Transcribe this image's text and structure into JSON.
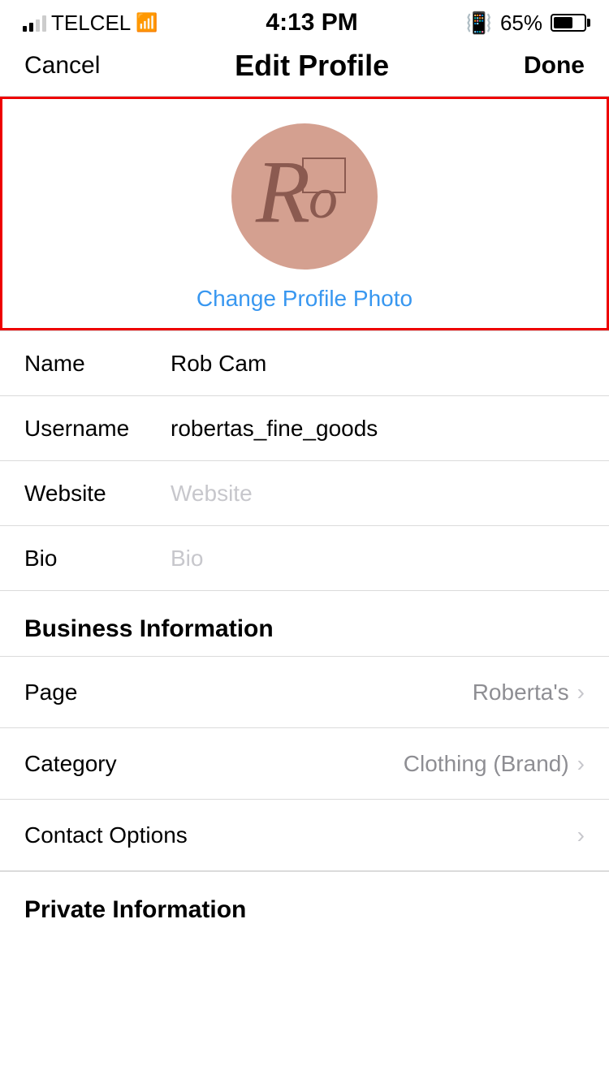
{
  "statusBar": {
    "carrier": "TELCEL",
    "time": "4:13 PM",
    "battery": "65%"
  },
  "nav": {
    "cancel": "Cancel",
    "title": "Edit Profile",
    "done": "Done"
  },
  "photo": {
    "changeText": "Change Profile Photo",
    "avatarLetter": "Ro"
  },
  "form": {
    "nameLabel": "Name",
    "nameValue": "Rob Cam",
    "usernameLabel": "Username",
    "usernameValue": "robertas_fine_goods",
    "websiteLabel": "Website",
    "websitePlaceholder": "Website",
    "bioLabel": "Bio",
    "bioPlaceholder": "Bio"
  },
  "businessSection": {
    "header": "Business Information",
    "pageLabel": "Page",
    "pageValue": "Roberta's",
    "categoryLabel": "Category",
    "categoryValue": "Clothing (Brand)",
    "contactLabel": "Contact Options"
  },
  "privateSection": {
    "header": "Private Information"
  }
}
